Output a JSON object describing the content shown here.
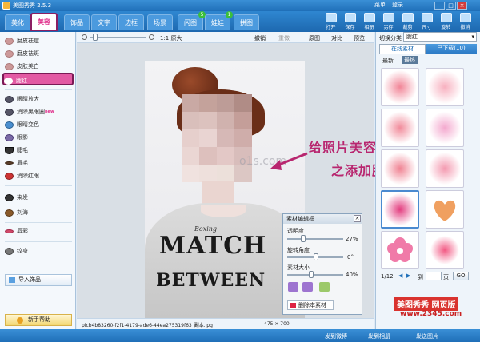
{
  "app": {
    "title": "美图秀秀 2.5.3",
    "top_menu": [
      "菜单",
      "登录"
    ]
  },
  "tabs": [
    {
      "label": "美化"
    },
    {
      "label": "美容"
    },
    {
      "label": "饰品"
    },
    {
      "label": "文字"
    },
    {
      "label": "边框"
    },
    {
      "label": "场景"
    },
    {
      "label": "闪图",
      "badge": "5"
    },
    {
      "label": "娃娃",
      "badge": "1"
    },
    {
      "label": "拼图"
    }
  ],
  "toolbar": [
    "打开",
    "保存",
    "相册",
    "另存",
    "裁剪",
    "尺寸",
    "旋转",
    "撤消"
  ],
  "sidebar": {
    "items": [
      "磨皮祛痘",
      "磨皮祛斑",
      "皮肤美白",
      "腮红",
      "眼睛放大",
      "消除黑眼圈",
      "眼睛变色",
      "眼影",
      "睫毛",
      "眉毛",
      "消除红眼",
      "染发",
      "刘海",
      "唇彩",
      "纹身"
    ],
    "new_tag": "new",
    "import_label": "导入饰品",
    "help_label": "新手帮助"
  },
  "edit_toolbar": {
    "zoom_label": "1:1 原大",
    "undo": "撤销",
    "redo": "重做",
    "original": "原图",
    "compare": "对比",
    "preview": "预览"
  },
  "status": {
    "filename": "picb4b83260-f2f1-4179-ade6-44ea275319f63_副本.jpg",
    "dimensions": "475 × 700"
  },
  "annotation": {
    "line1": "给照片美容",
    "line2": "之添加腮红",
    "watermark": "o1s.com"
  },
  "shirt": {
    "brand": "Boxing",
    "line1": "MATCH",
    "line2": "BETWEEN"
  },
  "right_panel": {
    "category_label": "切换分类",
    "category_value": "腮红",
    "tab_online": "在线素材",
    "tab_downloaded": "已下载(10)",
    "sub_latest": "最新",
    "sub_hot": "最热",
    "pager": "1/12",
    "goto": "到",
    "page_unit": "页",
    "go": "GO",
    "nav_left": "◀",
    "nav_right": "▶",
    "swatches": [
      "blush-pink",
      "blush-pink",
      "blush-pink",
      "blush-pink",
      "blush-pink",
      "blush-pink",
      "blush-magenta",
      "heart-orange",
      "flower-pink",
      "blush-pink"
    ]
  },
  "material_editor": {
    "title": "素材编辑框",
    "opacity_label": "透明度",
    "opacity_value": "27%",
    "rotation_label": "旋转角度",
    "rotation_value": "0°",
    "size_label": "素材大小",
    "size_value": "40%",
    "delete_label": "删除本素材"
  },
  "bottom": {
    "left": "发到微博",
    "mid": "发到相册",
    "right": "发送图片"
  },
  "overlay": {
    "line1": "美图秀秀 网页版",
    "line2": "www.2345.com"
  }
}
